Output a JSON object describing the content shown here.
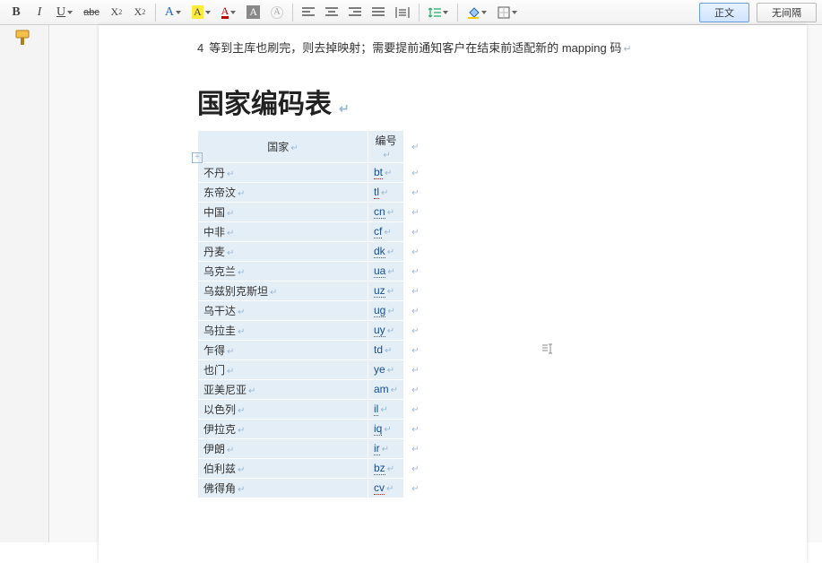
{
  "toolbar": {
    "bold": "B",
    "italic": "I",
    "underline": "U",
    "strike": "abc",
    "sub_base": "X",
    "sub_n": "2",
    "sup_base": "X",
    "sup_n": "2",
    "font_glyph": "A",
    "highlight_glyph": "A",
    "fontcolor_glyph": "A",
    "shading_glyph": "A",
    "clearfmt_glyph": "A",
    "style_body": "正文",
    "style_nospace": "无间隔"
  },
  "paragraph": {
    "num": "4",
    "text": "等到主库也刷完，则去掉映射；需要提前通知客户在结束前适配新的 mapping 码"
  },
  "heading": "国家编码表",
  "table": {
    "headers": {
      "country": "国家",
      "code": "编号"
    },
    "rows": [
      {
        "country": "不丹",
        "code": "bt",
        "sq": true
      },
      {
        "country": "东帝汶",
        "code": "tl",
        "sq": true
      },
      {
        "country": "中国",
        "code": "cn",
        "sq": true
      },
      {
        "country": "中非",
        "code": "cf",
        "sq": true
      },
      {
        "country": "丹麦",
        "code": "dk",
        "sq": true
      },
      {
        "country": "乌克兰",
        "code": "ua",
        "sq": true
      },
      {
        "country": "乌兹别克斯坦",
        "code": "uz",
        "sq": true
      },
      {
        "country": "乌干达",
        "code": "ug",
        "sq": true
      },
      {
        "country": "乌拉圭",
        "code": "uy",
        "sq": true
      },
      {
        "country": "乍得",
        "code": "td",
        "sq": false
      },
      {
        "country": "也门",
        "code": "ye",
        "sq": false
      },
      {
        "country": "亚美尼亚",
        "code": "am",
        "sq": false
      },
      {
        "country": "以色列",
        "code": "il",
        "sq": true
      },
      {
        "country": "伊拉克",
        "code": "iq",
        "sq": true
      },
      {
        "country": "伊朗",
        "code": "ir",
        "sq": true
      },
      {
        "country": "伯利兹",
        "code": "bz",
        "sq": true
      },
      {
        "country": "佛得角",
        "code": "cv",
        "sq": true
      }
    ]
  },
  "marks": {
    "para": "↵",
    "anchor": "+"
  }
}
